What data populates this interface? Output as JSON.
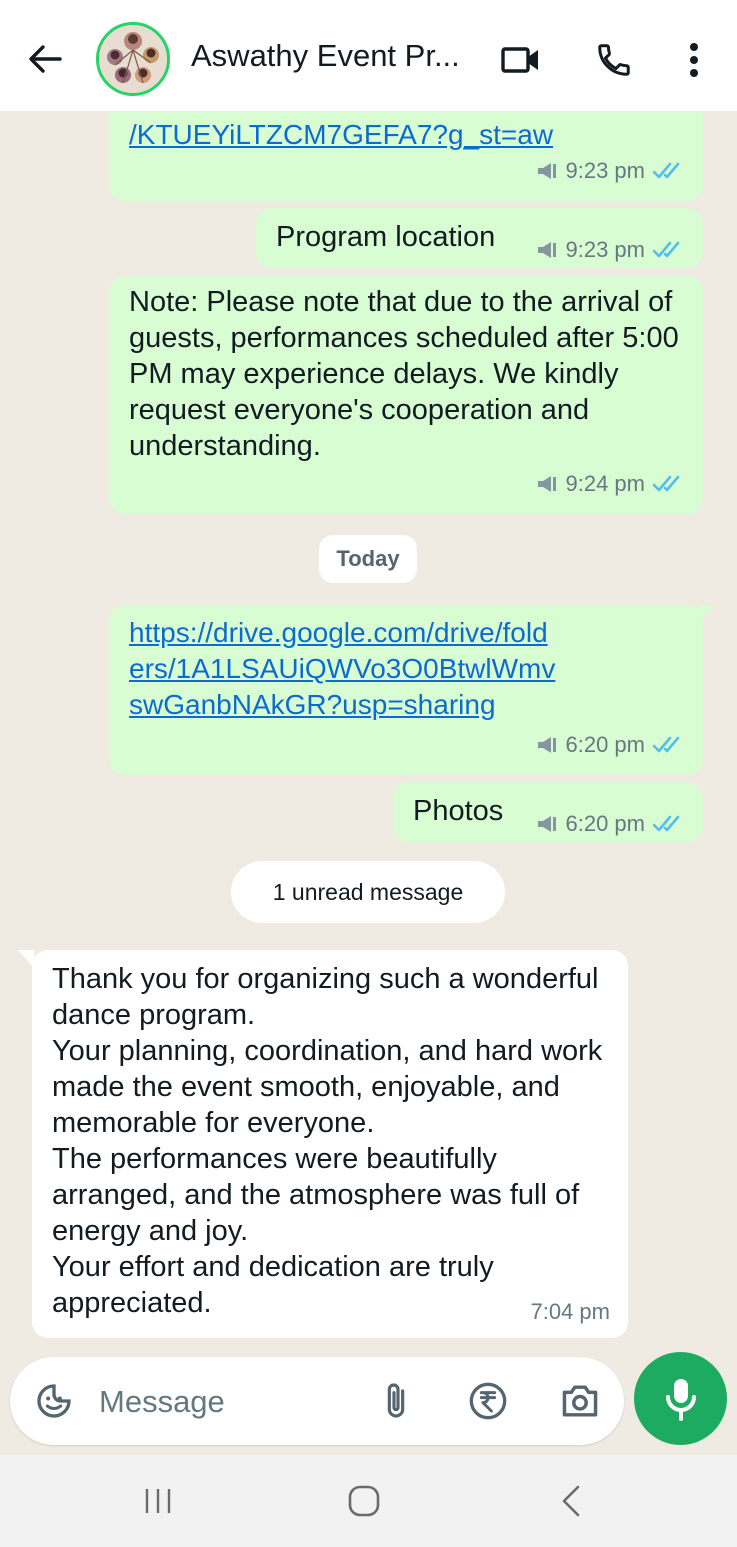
{
  "header": {
    "title": "Aswathy Event Pr...",
    "back_icon": "arrow-left-icon",
    "video_icon": "video-call-icon",
    "call_icon": "phone-icon",
    "menu_icon": "more-vertical-icon"
  },
  "messages": [
    {
      "type": "out",
      "text": "/KTUEYiLTZCM7GEFA7?g_st=aw",
      "time": "9:23 pm",
      "is_link": true
    },
    {
      "type": "out",
      "text": "Program location",
      "time": "9:23 pm"
    },
    {
      "type": "out",
      "text": "Note: Please note that due to the arrival of guests, performances scheduled after 5:00 PM may experience delays. We kindly request everyone's cooperation and understanding.",
      "time": "9:24 pm"
    },
    {
      "type": "out",
      "text": "https://drive.google.com/drive/folders/1A1LSAUiQWVo3O0BtwlWmvswGanbNAkGR?usp=sharing",
      "time": "6:20 pm",
      "is_link": true
    },
    {
      "type": "out",
      "text": "Photos",
      "time": "6:20 pm"
    },
    {
      "type": "in",
      "text": "Thank you for organizing such a wonderful dance program.\nYour planning, coordination, and hard work made the event smooth, enjoyable, and memorable for everyone.\nThe performances were beautifully arranged, and the atmosphere was full of energy and joy.\nYour effort and dedication are truly appreciated.",
      "time": "7:04 pm"
    }
  ],
  "date_divider": "Today",
  "unread_banner": "1 unread message",
  "composer": {
    "placeholder": "Message",
    "emoji_icon": "sticker-icon",
    "attach_icon": "paperclip-icon",
    "payment_icon": "rupee-icon",
    "camera_icon": "camera-icon",
    "mic_icon": "microphone-icon"
  },
  "colors": {
    "outgoing_bubble": "#d9fdd3",
    "incoming_bubble": "#ffffff",
    "chat_background": "#efeae2",
    "read_ticks": "#53bdeb",
    "mic_button": "#1daa61",
    "link": "#0b6bd1"
  }
}
